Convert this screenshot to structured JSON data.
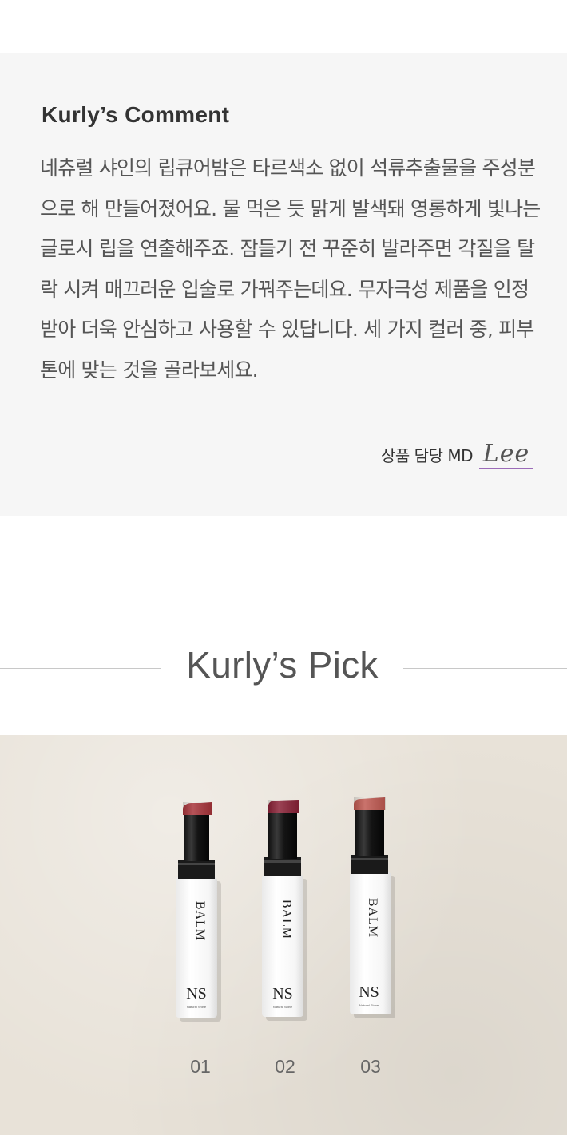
{
  "comment": {
    "title": "Kurly’s Comment",
    "body": "네츄럴 샤인의 립큐어밤은 타르색소 없이 석류추출물을 주성분으로 해 만들어졌어요. 물 먹은 듯 맑게 발색돼 영롱하게 빛나는 글로시 립을 연출해주죠. 잠들기 전 꾸준히 발라주면 각질을 탈락 시켜 매끄러운 입술로 가꿔주는데요. 무자극성 제품을 인정받아 더욱 안심하고 사용할 수 있답니다. 세 가지 컬러 중, 피부톤에 맞는 것을 골라보세요.",
    "md_label": "상품 담당 MD",
    "md_signature": "Lee"
  },
  "pick": {
    "title": "Kurly’s Pick"
  },
  "products": [
    {
      "number": "01",
      "product_text": "BALM",
      "brand": "NS",
      "brand_sub": "Natural Shine",
      "bullet_color": "#a8353b"
    },
    {
      "number": "02",
      "product_text": "BALM",
      "brand": "NS",
      "brand_sub": "Natural Shine",
      "bullet_color": "#8a2237"
    },
    {
      "number": "03",
      "product_text": "BALM",
      "brand": "NS",
      "brand_sub": "Natural Shine",
      "bullet_color": "#c05a52"
    }
  ],
  "colors": {
    "comment_bg": "#f6f6f6",
    "signature_underline": "#9b6bb8",
    "photo_bg": "#e8e2d8"
  }
}
